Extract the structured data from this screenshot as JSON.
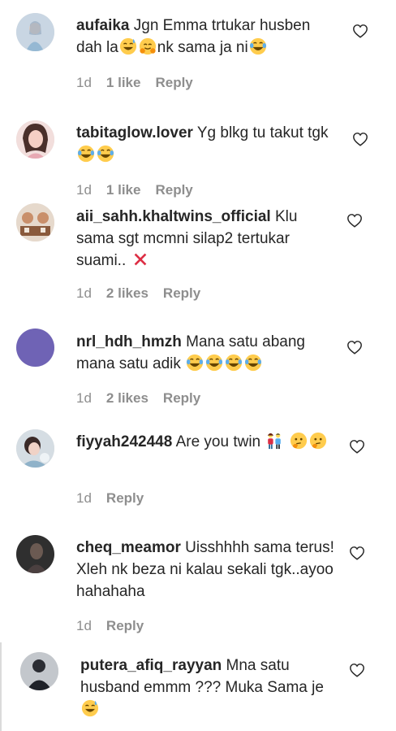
{
  "comments": [
    {
      "user": "aufaika",
      "text": "Jgn Emma trtukar husben dah la",
      "text2": "nk sama ja ni",
      "time": "1d",
      "likes": "1 like",
      "reply": "Reply",
      "avatar_color": "#b9c6d6"
    },
    {
      "user": "tabitaglow.lover",
      "text": "Yg blkg tu takut tgk",
      "time": "1d",
      "likes": "1 like",
      "reply": "Reply",
      "avatar_color": "#e9c2bf"
    },
    {
      "user": "aii_sahh.khaltwins_official",
      "text": "Klu sama sgt mcmni silap2 tertukar suami..",
      "time": "1d",
      "likes": "2 likes",
      "reply": "Reply",
      "avatar_color": "#d8c4b0"
    },
    {
      "user": "nrl_hdh_hmzh",
      "text": "Mana satu abang mana satu adik",
      "time": "1d",
      "likes": "2 likes",
      "reply": "Reply",
      "avatar_color": "#6f63b5"
    },
    {
      "user": "fiyyah242448",
      "text": "Are you twin",
      "time": "1d",
      "likes": "",
      "reply": "Reply",
      "avatar_color": "#cfd7de"
    },
    {
      "user": "cheq_meamor",
      "text": "Uisshhhh sama terus! Xleh nk beza ni kalau sekali tgk..ayoo hahahaha",
      "time": "1d",
      "likes": "",
      "reply": "Reply",
      "avatar_color": "#3a3a3a"
    },
    {
      "user": "putera_afiq_rayyan",
      "text": "Mna satu husband emmm ??? Muka Sama je",
      "avatar_color": "#4a4f58"
    }
  ],
  "colors": {
    "text": "#262626",
    "muted": "#8e8e8e",
    "emoji": "#ffcc4d",
    "cross": "#dd2e44"
  },
  "icons": {
    "like": "heart-outline-icon",
    "laugh": "tears-of-joy-emoji",
    "sweat": "grinning-sweat-emoji",
    "hug": "hugging-face-emoji",
    "cross": "cross-mark-emoji",
    "couple": "couple-emoji",
    "think": "thinking-face-emoji"
  }
}
